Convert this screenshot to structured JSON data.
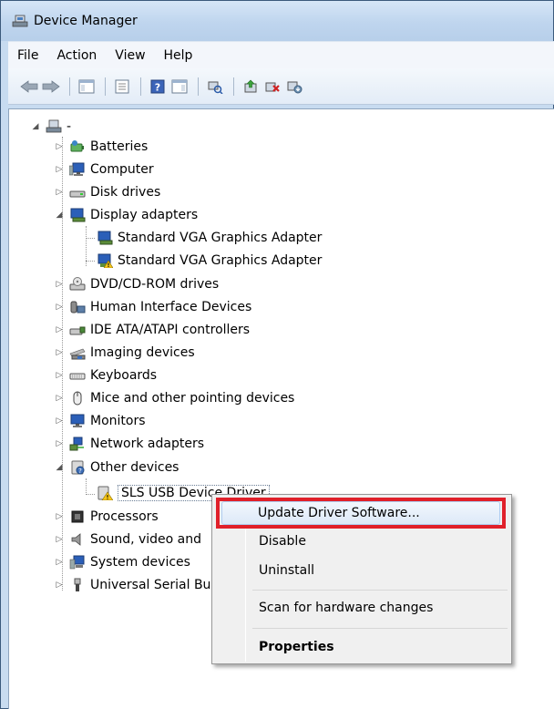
{
  "window": {
    "title": "Device Manager"
  },
  "menubar": {
    "items": [
      "File",
      "Action",
      "View",
      "Help"
    ]
  },
  "toolbar": {
    "buttons": [
      "back-arrow-icon",
      "forward-arrow-icon",
      "show-hide-console-tree-icon",
      "properties-icon",
      "help-icon",
      "action-pane-icon",
      "scan-hardware-icon",
      "update-driver-icon",
      "uninstall-icon",
      "enable-device-icon"
    ]
  },
  "tree": {
    "root_label": "-",
    "categories": [
      {
        "label": "Batteries"
      },
      {
        "label": "Computer"
      },
      {
        "label": "Disk drives"
      },
      {
        "label": "Display adapters",
        "expanded": true,
        "children": [
          {
            "label": "Standard VGA Graphics Adapter"
          },
          {
            "label": "Standard VGA Graphics Adapter",
            "warning": true
          }
        ]
      },
      {
        "label": "DVD/CD-ROM drives"
      },
      {
        "label": "Human Interface Devices"
      },
      {
        "label": "IDE ATA/ATAPI controllers"
      },
      {
        "label": "Imaging devices"
      },
      {
        "label": "Keyboards"
      },
      {
        "label": "Mice and other pointing devices"
      },
      {
        "label": "Monitors"
      },
      {
        "label": "Network adapters"
      },
      {
        "label": "Other devices",
        "expanded": true,
        "children": [
          {
            "label": "SLS USB Device Driver",
            "warning": true,
            "selected": true
          }
        ]
      },
      {
        "label": "Processors"
      },
      {
        "label": "Sound, video and"
      },
      {
        "label": "System devices"
      },
      {
        "label": "Universal Serial Bu"
      }
    ]
  },
  "context_menu": {
    "items": [
      {
        "label": "Update Driver Software...",
        "highlighted": true
      },
      {
        "label": "Disable"
      },
      {
        "label": "Uninstall"
      },
      {
        "label": "Scan for hardware changes"
      },
      {
        "label": "Properties",
        "bold": true
      }
    ],
    "highlight_color": "#e0202a"
  }
}
